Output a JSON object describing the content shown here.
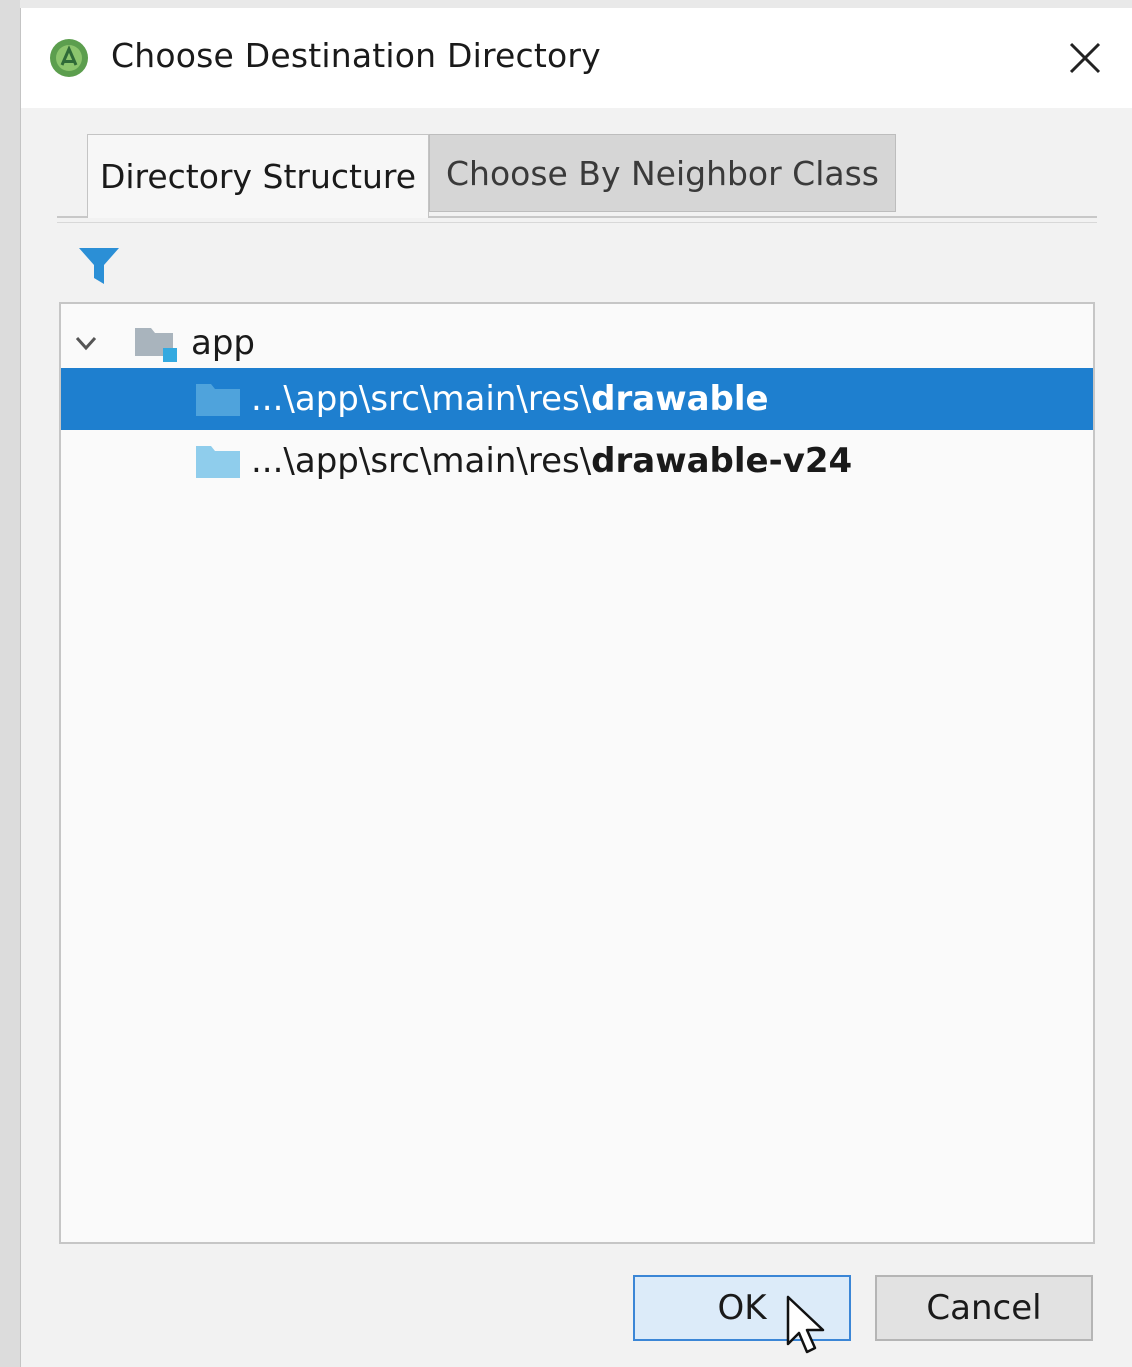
{
  "dialog": {
    "title": "Choose Destination Directory",
    "icon": "android-studio-icon",
    "close_icon": "close-icon"
  },
  "tabs": [
    {
      "label": "Directory Structure",
      "active": true
    },
    {
      "label": "Choose By Neighbor Class",
      "active": false
    }
  ],
  "toolbar": {
    "filter_icon": "filter-icon"
  },
  "tree": {
    "root": {
      "label": "app",
      "expanded": true,
      "icon": "module-folder-icon"
    },
    "items": [
      {
        "path_prefix": "...\\app\\src\\main\\res\\",
        "name": "drawable",
        "selected": true,
        "icon": "folder-icon"
      },
      {
        "path_prefix": "...\\app\\src\\main\\res\\",
        "name": "drawable-v24",
        "selected": false,
        "icon": "folder-icon"
      }
    ]
  },
  "buttons": {
    "ok_label": "OK",
    "cancel_label": "Cancel"
  },
  "colors": {
    "selection": "#1e7fcf",
    "folder": "#7fc3e8",
    "accent": "#3b86d6",
    "filter": "#2b8fd6"
  }
}
